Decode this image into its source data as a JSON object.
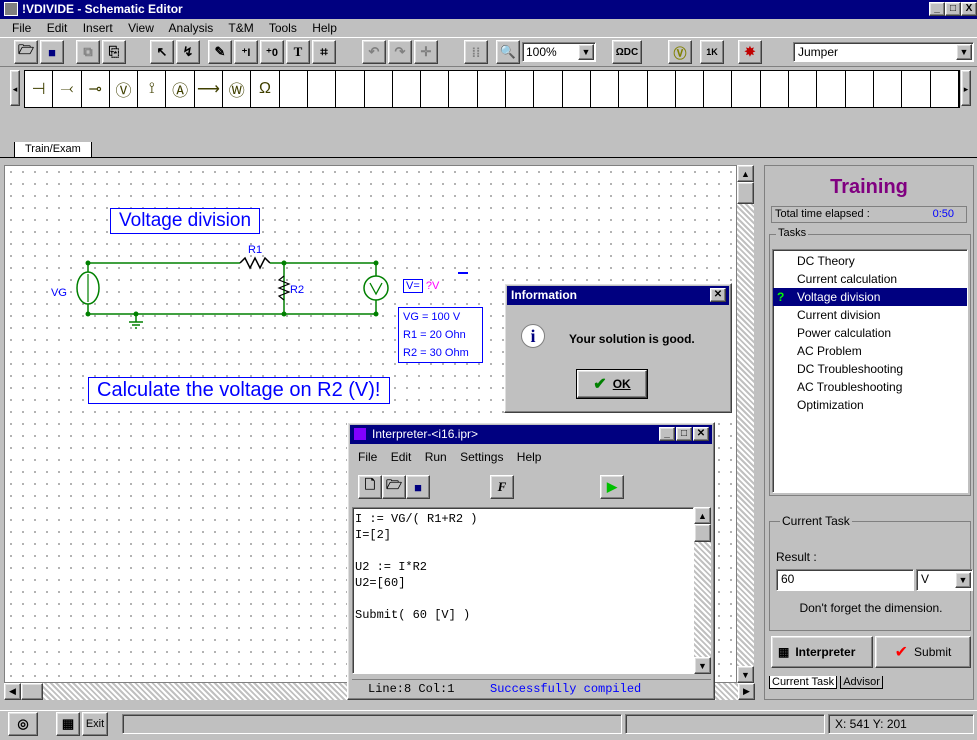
{
  "window": {
    "title": "!VDIVIDE - Schematic Editor",
    "buttons": [
      "_",
      "□",
      "X"
    ]
  },
  "menu": [
    "File",
    "Edit",
    "Insert",
    "View",
    "Analysis",
    "T&M",
    "Tools",
    "Help"
  ],
  "toolbar": {
    "zoom": "100%",
    "component": "Jumper",
    "dc_label": "DC",
    "k_label": "1K"
  },
  "tab": "Train/Exam",
  "schematic": {
    "title": "Voltage division",
    "vg_label": "VG",
    "r1_label": "R1",
    "r2_label": "R2",
    "vm_label": "V=",
    "vm_value": "?V",
    "params": [
      "VG = 100 V",
      "R1 =  20 Ohn",
      "R2 =  30 Ohm"
    ],
    "task": "Calculate the voltage on R2 (V)!"
  },
  "info_dialog": {
    "title": "Information",
    "message": "Your solution is good.",
    "ok": "OK"
  },
  "interpreter": {
    "title": "Interpreter-<i16.ipr>",
    "menu": [
      "File",
      "Edit",
      "Run",
      "Settings",
      "Help"
    ],
    "code": [
      "I := VG/( R1+R2 )",
      "I=[2]",
      "",
      "U2 := I*R2",
      "U2=[60]",
      "",
      "Submit( 60 [V] )"
    ],
    "status_pos": "Line:8 Col:1",
    "status_msg": "Successfully compiled"
  },
  "training": {
    "title": "Training",
    "time_label": "Total time elapsed :",
    "time_value": "0:50",
    "tasks_label": "Tasks",
    "tasks": [
      "DC Theory",
      "Current calculation",
      "Voltage division",
      "Current division",
      "Power calculation",
      "AC Problem",
      "DC Troubleshooting",
      "AC Troubleshooting",
      "Optimization"
    ],
    "selected_index": 2,
    "current_task_label": "Current Task",
    "result_label": "Result :",
    "result_value": "60",
    "unit": "V",
    "hint": "Don't forget the dimension.",
    "interpreter_btn": "Interpreter",
    "submit_btn": "Submit",
    "tabs": [
      "Current Task",
      "Advisor"
    ]
  },
  "statusbar": {
    "exit": "Exit",
    "coords": "X: 541  Y: 201"
  },
  "colors": {
    "titlebar": "#000080",
    "training_title": "#800080",
    "schematic_blue": "#0000ff",
    "circuit_green": "#008000",
    "status_blue": "#0000ff"
  }
}
